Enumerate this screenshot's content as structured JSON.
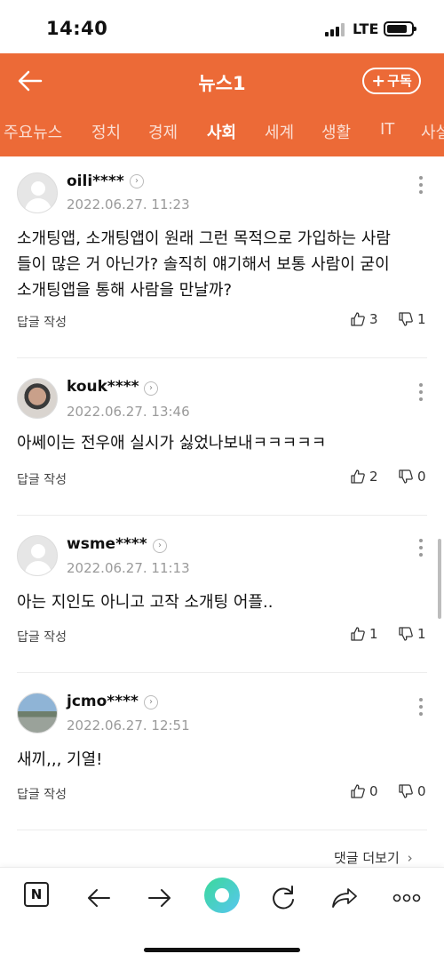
{
  "status_bar": {
    "time": "14:40",
    "network": "LTE"
  },
  "header": {
    "title": "뉴스1",
    "subscribe_label": "구독"
  },
  "tabs": [
    "주요뉴스",
    "정치",
    "경제",
    "사회",
    "세계",
    "생활",
    "IT",
    "사설"
  ],
  "active_tab": "사회",
  "comments": [
    {
      "user": "oili****",
      "date": "2022.06.27. 11:23",
      "text_lines": [
        "소개팅앱, 소개팅앱이 원래 그런 목적으로 가입하는 사람",
        "들이 많은 거 아닌가? 솔직히 얘기해서 보통 사람이 굳이",
        "소개팅앱을 통해 사람을 만날까?"
      ],
      "reply_label": "답글 작성",
      "likes": "3",
      "dislikes": "1"
    },
    {
      "user": "kouk****",
      "date": "2022.06.27. 13:46",
      "text_lines": [
        "아쎄이는 전우애 실시가 싫었나보내ㅋㅋㅋㅋㅋ"
      ],
      "reply_label": "답글 작성",
      "likes": "2",
      "dislikes": "0"
    },
    {
      "user": "wsme****",
      "date": "2022.06.27. 11:13",
      "text_lines": [
        "아는 지인도 아니고 고작 소개팅 어플.."
      ],
      "reply_label": "답글 작성",
      "likes": "1",
      "dislikes": "1"
    },
    {
      "user": "jcmo****",
      "date": "2022.06.27. 12:51",
      "text_lines": [
        "새끼,,, 기열!"
      ],
      "reply_label": "답글 작성",
      "likes": "0",
      "dislikes": "0"
    }
  ],
  "more_comments_label": "댓글 더보기",
  "toolbar": {
    "n_label": "N"
  },
  "colors": {
    "accent": "#ec6a37",
    "text": "#111111",
    "muted": "#9a9a9a"
  }
}
